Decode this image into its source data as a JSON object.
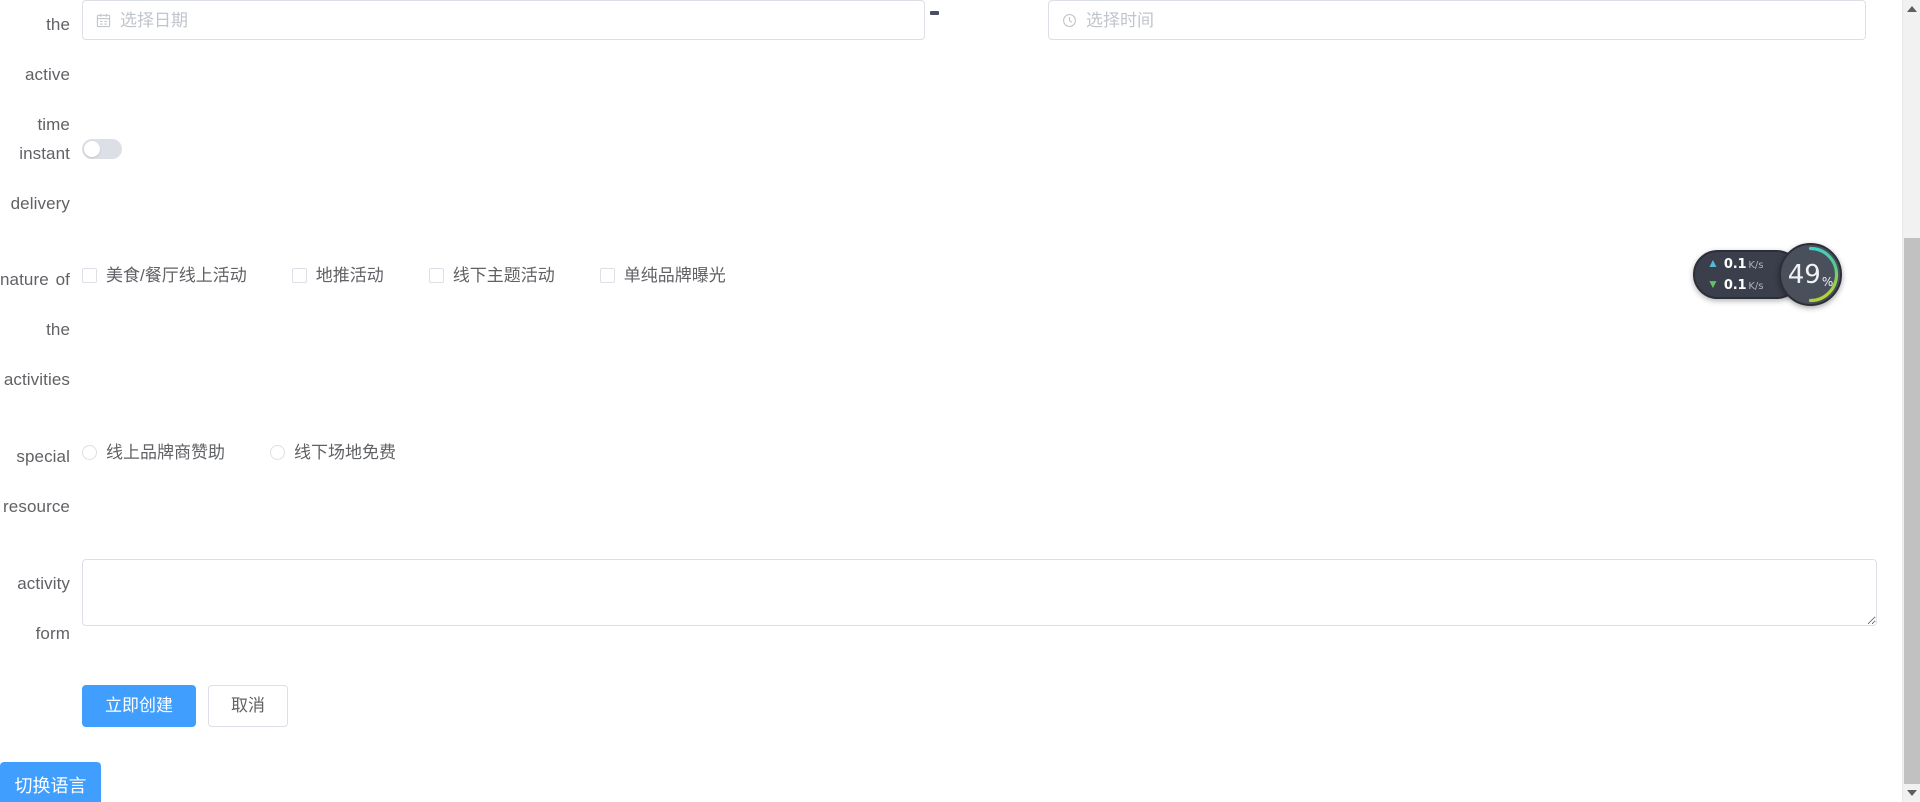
{
  "form": {
    "rows": [
      {
        "key": "active_time",
        "label": "the active time",
        "type": "datetime-range",
        "date_placeholder": "选择日期",
        "time_placeholder": "选择时间",
        "separator": "-",
        "date_icon": "calendar-icon",
        "time_icon": "clock-icon"
      },
      {
        "key": "instant_delivery",
        "label": "instant delivery",
        "type": "switch",
        "checked": false
      },
      {
        "key": "activity_nature",
        "label": "nature of the activities",
        "type": "checkbox-group",
        "options": [
          {
            "label": "美食/餐厅线上活动",
            "checked": false
          },
          {
            "label": "地推活动",
            "checked": false
          },
          {
            "label": "线下主题活动",
            "checked": false
          },
          {
            "label": "单纯品牌曝光",
            "checked": false
          }
        ]
      },
      {
        "key": "special_resource",
        "label": "special resource",
        "type": "radio-group",
        "options": [
          {
            "label": "线上品牌商赞助",
            "checked": false
          },
          {
            "label": "线下场地免费",
            "checked": false
          }
        ]
      },
      {
        "key": "activity_form",
        "label": "activity form",
        "type": "textarea",
        "value": "",
        "placeholder": ""
      }
    ],
    "actions": {
      "submit_label": "立即创建",
      "cancel_label": "取消"
    }
  },
  "language_switch": {
    "label": "切换语言"
  },
  "network_widget": {
    "upload": {
      "value": "0.1",
      "unit": "K/s",
      "arrow": "arrow-up-icon"
    },
    "download": {
      "value": "0.1",
      "unit": "K/s",
      "arrow": "arrow-down-icon"
    },
    "gauge": {
      "percent": "49",
      "symbol": "%",
      "value": 49
    }
  },
  "colors": {
    "primary": "#409eff",
    "border": "#dcdfe6",
    "label_text": "#606266",
    "placeholder": "#c0c4cc",
    "widget_bg": "#3a3f4b",
    "gauge_start": "#3fd0c9",
    "gauge_end": "#b4d334",
    "upload_arrow": "#55b8d6",
    "download_arrow": "#62c462",
    "scrollbar_thumb": "#c1c1c1",
    "scrollbar_track": "#f1f1f1"
  },
  "scrollbar": {
    "up_icon": "triangle-up-icon",
    "down_icon": "triangle-down-icon"
  }
}
